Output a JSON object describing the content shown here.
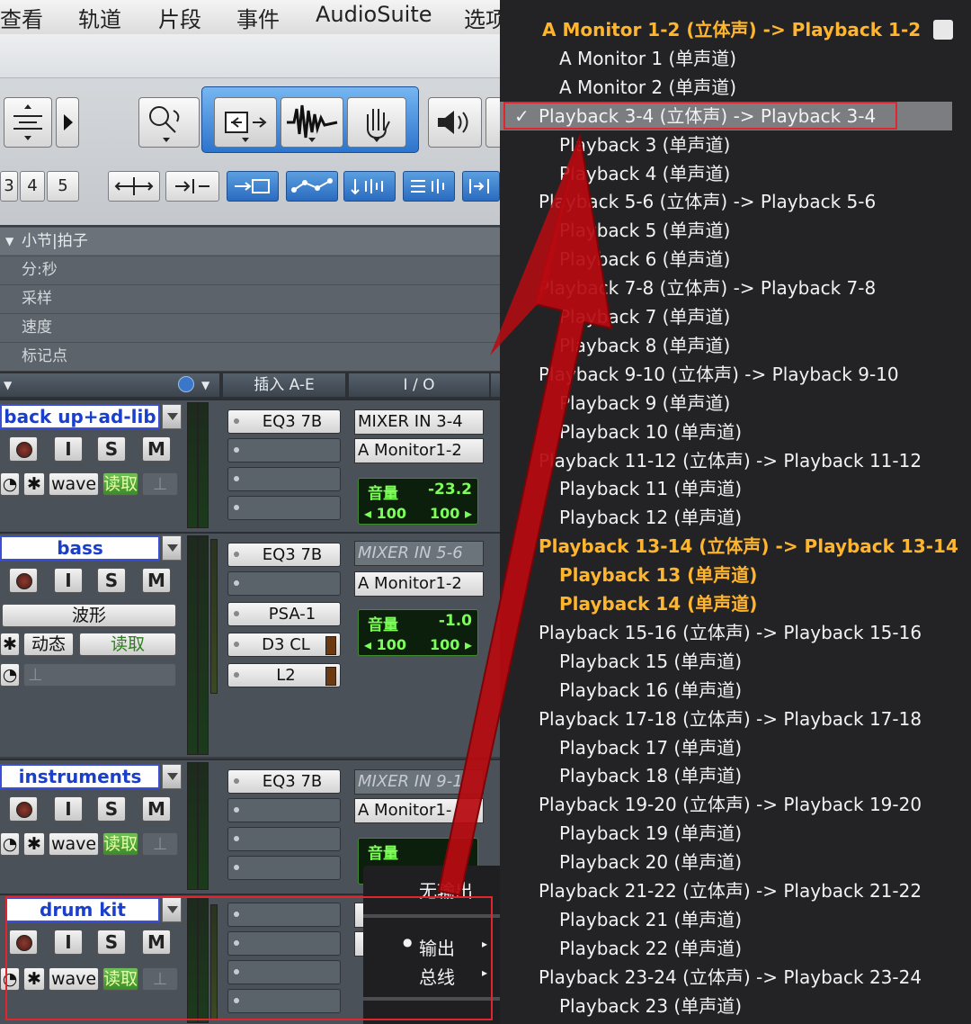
{
  "menubar": {
    "items": [
      "查看",
      "轨道",
      "片段",
      "事件",
      "AudioSuite",
      "选项"
    ]
  },
  "toolbar": {
    "numbers": [
      "3",
      "4",
      "5"
    ]
  },
  "ruler": {
    "rows": [
      "小节|拍子",
      "分:秒",
      "采样",
      "速度",
      "标记点"
    ]
  },
  "header": {
    "inserts": "插入 A-E",
    "io": "I / O"
  },
  "tracks": [
    {
      "name": "back up+ad-lib",
      "rec": "",
      "input": "I",
      "solo": "S",
      "mute": "M",
      "view": "wave",
      "auto": "读取",
      "inserts": [
        "EQ3 7B"
      ],
      "io_in": "MIXER IN 3-4",
      "io_out": "A Monitor1-2",
      "vol_label": "音量",
      "vol_value": "-23.2",
      "pan_l": "◂ 100",
      "pan_r": "100 ▸"
    },
    {
      "name": "bass",
      "rec": "",
      "input": "I",
      "solo": "S",
      "mute": "M",
      "view": "波形",
      "dyn": "动态",
      "auto": "读取",
      "inserts": [
        "EQ3 7B",
        "",
        "PSA-1",
        "D3 CL",
        "L2"
      ],
      "io_in": "MIXER IN 5-6",
      "io_out": "A Monitor1-2",
      "vol_label": "音量",
      "vol_value": "-1.0",
      "pan_l": "◂ 100",
      "pan_r": "100 ▸"
    },
    {
      "name": "instruments",
      "rec": "",
      "input": "I",
      "solo": "S",
      "mute": "M",
      "view": "wave",
      "auto": "读取",
      "inserts": [
        "EQ3 7B"
      ],
      "io_in": "MIXER IN 9-1",
      "io_out": "A Monitor1-",
      "vol_label": "音量"
    },
    {
      "name": "drum kit",
      "rec": "",
      "input": "I",
      "solo": "S",
      "mute": "M",
      "view": "wave",
      "auto": "读取"
    }
  ],
  "context_menu": {
    "no_output": "无输出",
    "output": "输出",
    "bus": "总线"
  },
  "dropdown": {
    "items": [
      {
        "label": "A Monitor 1-2 (立体声) -> Playback 1-2",
        "indent": 0,
        "highlight": true
      },
      {
        "label": "A Monitor 1 (单声道)",
        "indent": 1
      },
      {
        "label": "A Monitor 2 (单声道)",
        "indent": 1
      },
      {
        "label": "Playback 3-4 (立体声) -> Playback 3-4",
        "indent": 0,
        "checked": true
      },
      {
        "label": "Playback 3 (单声道)",
        "indent": 1
      },
      {
        "label": "Playback 4 (单声道)",
        "indent": 1
      },
      {
        "label": "Playback 5-6 (立体声) -> Playback 5-6",
        "indent": 0
      },
      {
        "label": "Playback 5 (单声道)",
        "indent": 1
      },
      {
        "label": "Playback 6 (单声道)",
        "indent": 1
      },
      {
        "label": "Playback 7-8 (立体声) -> Playback 7-8",
        "indent": 0
      },
      {
        "label": "Playback 7 (单声道)",
        "indent": 1
      },
      {
        "label": "Playback 8 (单声道)",
        "indent": 1
      },
      {
        "label": "Playback 9-10 (立体声) -> Playback 9-10",
        "indent": 0
      },
      {
        "label": "Playback 9 (单声道)",
        "indent": 1
      },
      {
        "label": "Playback 10 (单声道)",
        "indent": 1
      },
      {
        "label": "Playback 11-12 (立体声) -> Playback 11-12",
        "indent": 0
      },
      {
        "label": "Playback 11 (单声道)",
        "indent": 1
      },
      {
        "label": "Playback 12 (单声道)",
        "indent": 1
      },
      {
        "label": "Playback 13-14 (立体声) -> Playback 13-14",
        "indent": 0,
        "highlight": true
      },
      {
        "label": "Playback 13 (单声道)",
        "indent": 1,
        "highlight": true
      },
      {
        "label": "Playback 14 (单声道)",
        "indent": 1,
        "highlight": true
      },
      {
        "label": "Playback 15-16 (立体声) -> Playback 15-16",
        "indent": 0
      },
      {
        "label": "Playback 15 (单声道)",
        "indent": 1
      },
      {
        "label": "Playback 16 (单声道)",
        "indent": 1
      },
      {
        "label": "Playback 17-18 (立体声) -> Playback 17-18",
        "indent": 0
      },
      {
        "label": "Playback 17 (单声道)",
        "indent": 1
      },
      {
        "label": "Playback 18 (单声道)",
        "indent": 1
      },
      {
        "label": "Playback 19-20 (立体声) -> Playback 19-20",
        "indent": 0
      },
      {
        "label": "Playback 19 (单声道)",
        "indent": 1
      },
      {
        "label": "Playback 20 (单声道)",
        "indent": 1
      },
      {
        "label": "Playback 21-22 (立体声) -> Playback 21-22",
        "indent": 0
      },
      {
        "label": "Playback 21 (单声道)",
        "indent": 1
      },
      {
        "label": "Playback 22 (单声道)",
        "indent": 1
      },
      {
        "label": "Playback 23-24 (立体声) -> Playback 23-24",
        "indent": 0
      },
      {
        "label": "Playback 23 (单声道)",
        "indent": 1
      }
    ],
    "check_mark": "✓"
  },
  "colors": {
    "highlight": "#ffb52e",
    "annotation_red": "#e0252f",
    "arrow_red": "#b70b10",
    "track_name": "#1a3fcc"
  }
}
